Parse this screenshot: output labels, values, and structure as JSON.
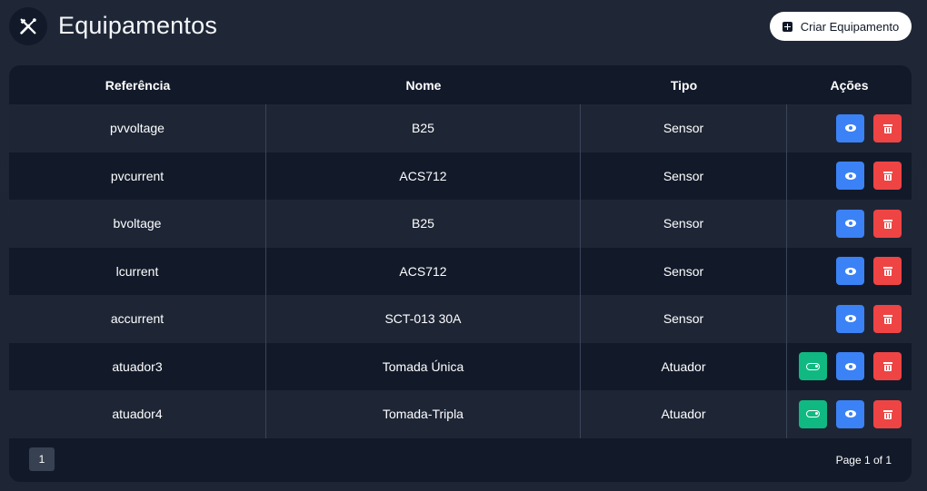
{
  "header": {
    "title": "Equipamentos",
    "title_icon": "tools-icon",
    "create_button_label": "Criar Equipamento",
    "create_button_icon": "plus-square-icon"
  },
  "table": {
    "columns": [
      "Referência",
      "Nome",
      "Tipo",
      "Ações"
    ],
    "rows": [
      {
        "referencia": "pvvoltage",
        "nome": "B25",
        "tipo": "Sensor",
        "has_toggle": false
      },
      {
        "referencia": "pvcurrent",
        "nome": "ACS712",
        "tipo": "Sensor",
        "has_toggle": false
      },
      {
        "referencia": "bvoltage",
        "nome": "B25",
        "tipo": "Sensor",
        "has_toggle": false
      },
      {
        "referencia": "lcurrent",
        "nome": "ACS712",
        "tipo": "Sensor",
        "has_toggle": false
      },
      {
        "referencia": "accurrent",
        "nome": "SCT-013 30A",
        "tipo": "Sensor",
        "has_toggle": false
      },
      {
        "referencia": "atuador3",
        "nome": "Tomada Única",
        "tipo": "Atuador",
        "has_toggle": true
      },
      {
        "referencia": "atuador4",
        "nome": "Tomada-Tripla",
        "tipo": "Atuador",
        "has_toggle": true
      }
    ]
  },
  "pagination": {
    "current_page_label": "1",
    "page_info": "Page 1 of 1"
  },
  "colors": {
    "background": "#1e2636",
    "card": "#121a2a",
    "view_button": "#3b82f6",
    "delete_button": "#ef4444",
    "toggle_button": "#10b981"
  }
}
